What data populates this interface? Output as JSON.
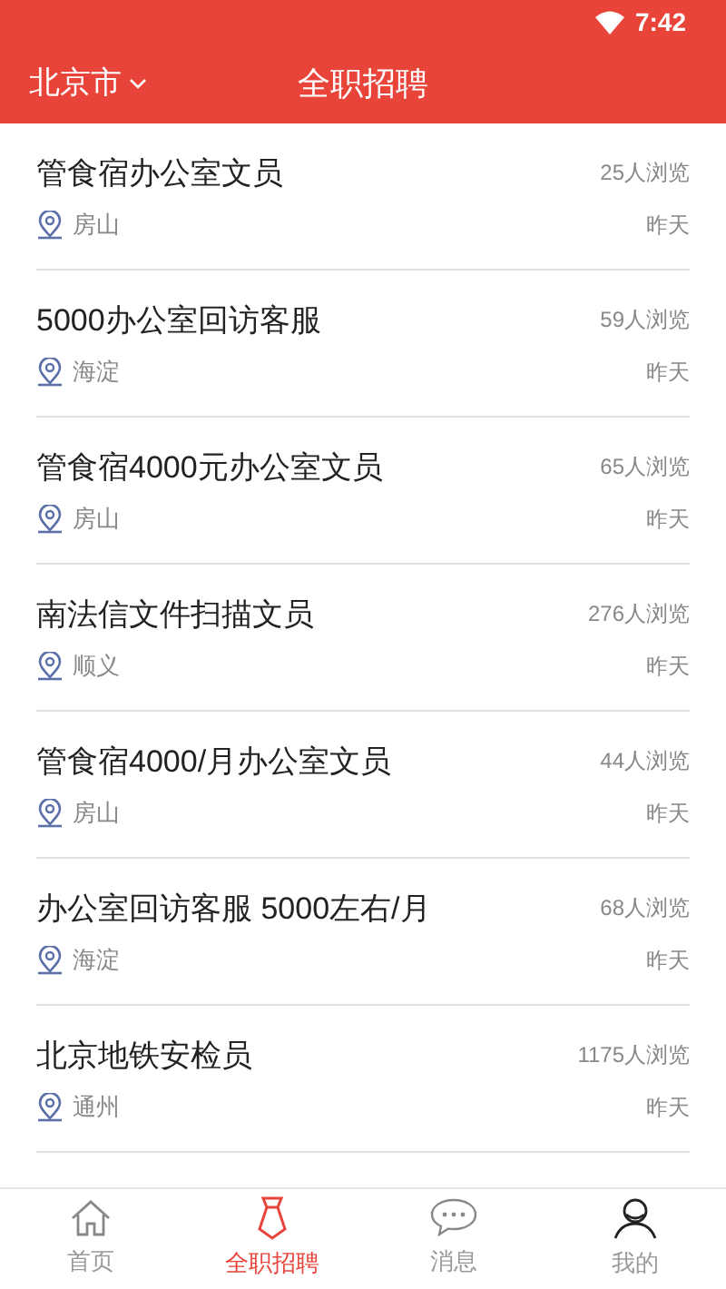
{
  "status_bar": {
    "time": "7:42"
  },
  "header": {
    "city": "北京市",
    "title": "全职招聘"
  },
  "jobs": [
    {
      "title": "管食宿办公室文员",
      "views": "25人浏览",
      "location": "房山",
      "date": "昨天"
    },
    {
      "title": "5000办公室回访客服",
      "views": "59人浏览",
      "location": "海淀",
      "date": "昨天"
    },
    {
      "title": "管食宿4000元办公室文员",
      "views": "65人浏览",
      "location": "房山",
      "date": "昨天"
    },
    {
      "title": "南法信文件扫描文员",
      "views": "276人浏览",
      "location": "顺义",
      "date": "昨天"
    },
    {
      "title": "管食宿4000/月办公室文员",
      "views": "44人浏览",
      "location": "房山",
      "date": "昨天"
    },
    {
      "title": "办公室回访客服 5000左右/月",
      "views": "68人浏览",
      "location": "海淀",
      "date": "昨天"
    },
    {
      "title": "北京地铁安检员",
      "views": "1175人浏览",
      "location": "通州",
      "date": "昨天"
    }
  ],
  "tab_bar": [
    {
      "label": "首页",
      "selected": false,
      "kind": "home"
    },
    {
      "label": "全职招聘",
      "selected": true,
      "kind": "tie"
    },
    {
      "label": "消息",
      "selected": false,
      "kind": "chat"
    },
    {
      "label": "我的",
      "selected": false,
      "kind": "person"
    }
  ]
}
